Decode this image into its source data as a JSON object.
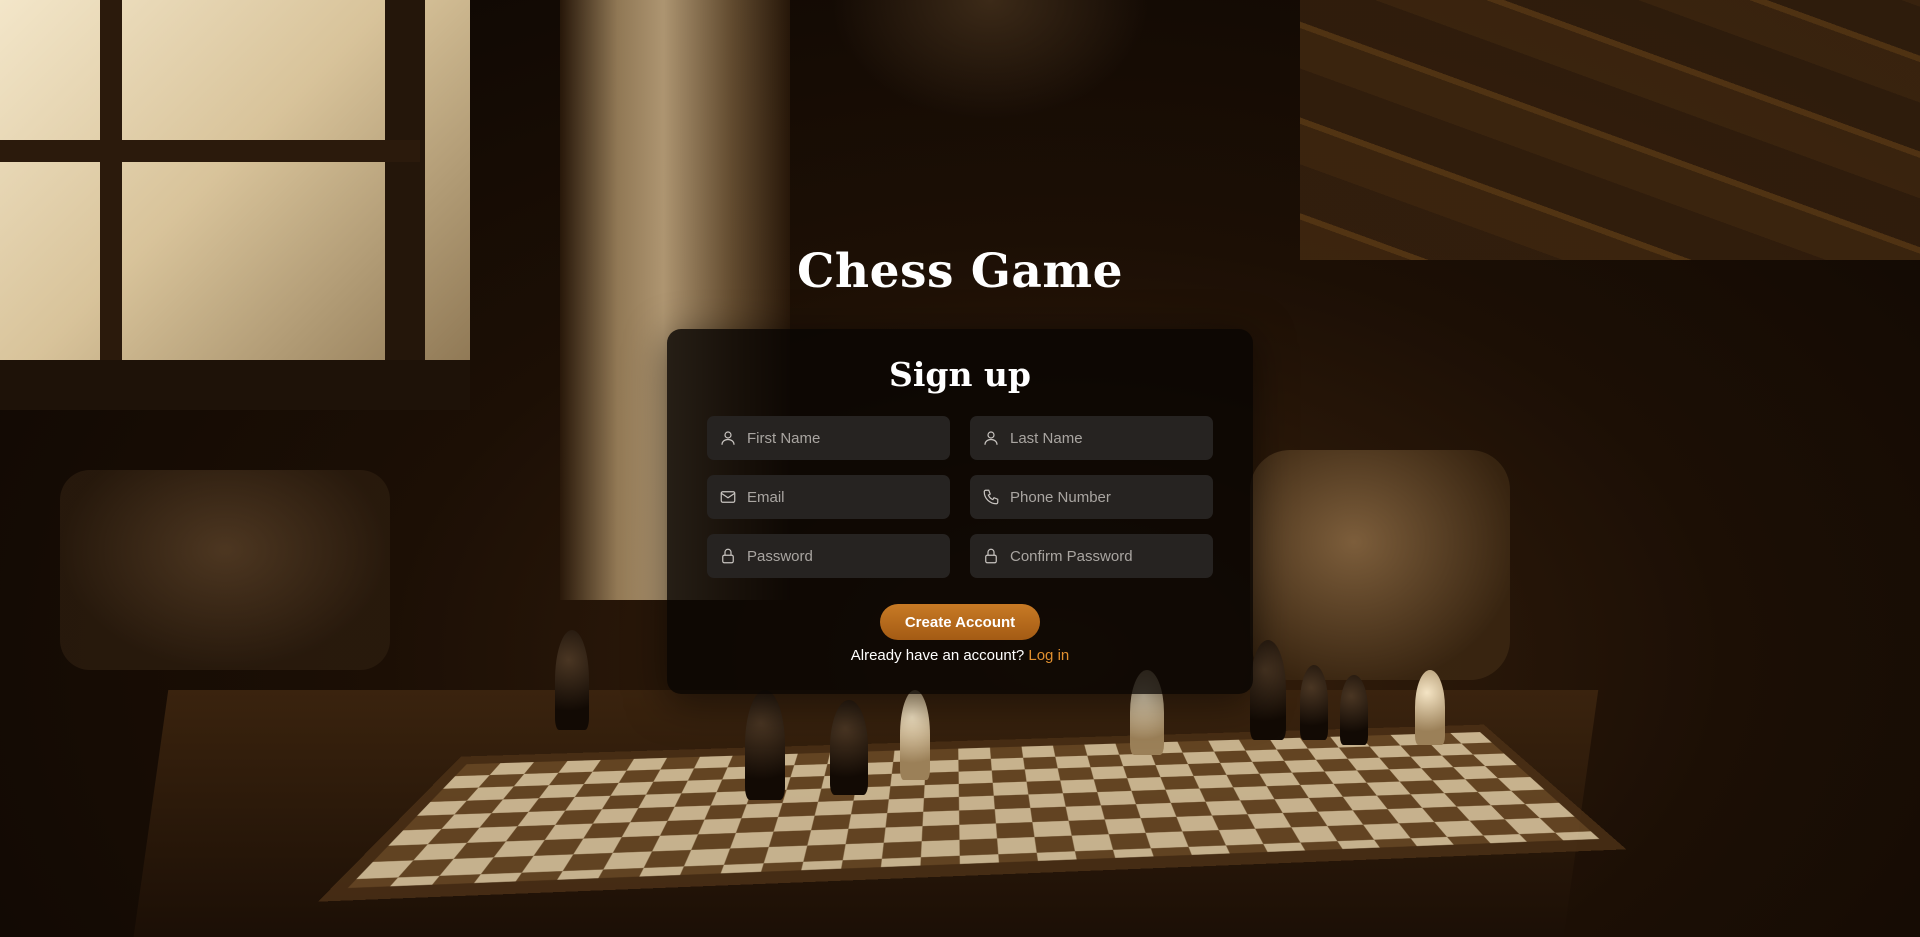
{
  "app_title": "Chess Game",
  "form": {
    "title": "Sign up",
    "fields": {
      "first_name": {
        "placeholder": "First Name",
        "icon": "user-icon"
      },
      "last_name": {
        "placeholder": "Last Name",
        "icon": "user-icon"
      },
      "email": {
        "placeholder": "Email",
        "icon": "mail-icon"
      },
      "phone": {
        "placeholder": "Phone Number",
        "icon": "phone-icon"
      },
      "password": {
        "placeholder": "Password",
        "icon": "lock-icon"
      },
      "confirm_password": {
        "placeholder": "Confirm Password",
        "icon": "lock-icon"
      }
    },
    "submit_label": "Create Account",
    "login_prompt": "Already have an account?",
    "login_link": "Log in"
  },
  "colors": {
    "accent": "#c87a25",
    "link": "#e08f2f",
    "card_bg": "#080503",
    "field_bg": "#262321"
  }
}
